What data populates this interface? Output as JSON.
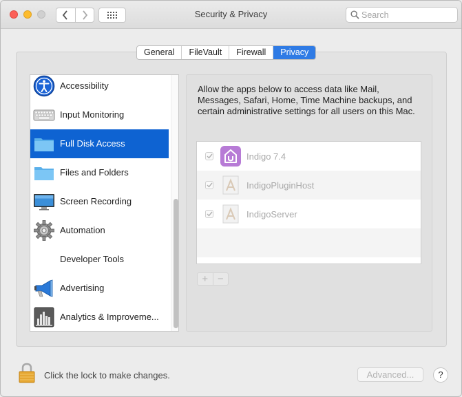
{
  "window": {
    "title": "Security & Privacy",
    "search_placeholder": "Search"
  },
  "tabs": [
    {
      "label": "General",
      "active": false
    },
    {
      "label": "FileVault",
      "active": false
    },
    {
      "label": "Firewall",
      "active": false
    },
    {
      "label": "Privacy",
      "active": true
    }
  ],
  "sidebar": {
    "items": [
      {
        "label": "Accessibility",
        "icon": "accessibility-icon"
      },
      {
        "label": "Input Monitoring",
        "icon": "keyboard-icon"
      },
      {
        "label": "Full Disk Access",
        "icon": "folder-icon",
        "selected": true
      },
      {
        "label": "Files and Folders",
        "icon": "folder-icon"
      },
      {
        "label": "Screen Recording",
        "icon": "display-icon"
      },
      {
        "label": "Automation",
        "icon": "gear-icon"
      },
      {
        "label": "Developer Tools",
        "icon": ""
      },
      {
        "label": "Advertising",
        "icon": "megaphone-icon"
      },
      {
        "label": "Analytics & Improveme...",
        "icon": "analytics-icon"
      }
    ]
  },
  "content": {
    "description": "Allow the apps below to access data like Mail, Messages, Safari, Home, Time Machine backups, and certain administrative settings for all users on this Mac.",
    "apps": [
      {
        "name": "Indigo 7.4",
        "checked": true,
        "icon": "indigo-home-icon"
      },
      {
        "name": "IndigoPluginHost",
        "checked": true,
        "icon": "app-generic-icon"
      },
      {
        "name": "IndigoServer",
        "checked": true,
        "icon": "app-generic-icon"
      }
    ],
    "add_label": "+",
    "remove_label": "−"
  },
  "footer": {
    "lock_text": "Click the lock to make changes.",
    "advanced_label": "Advanced...",
    "help_label": "?"
  },
  "colors": {
    "accent": "#2f7be5",
    "selection": "#0e63d2",
    "lock": "#e5a631",
    "indigo_icon": "#b77bd6"
  }
}
